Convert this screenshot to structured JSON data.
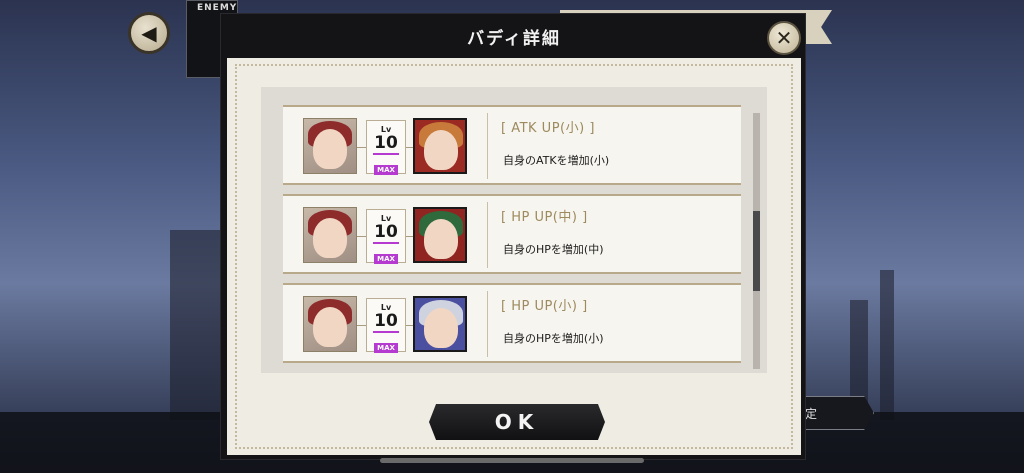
{
  "header": {
    "enemy_label": "ENEMY",
    "back_icon": "chevron-left-icon"
  },
  "background": {
    "right_button_label": "定"
  },
  "modal": {
    "title": "バディ詳細",
    "close_icon": "close-icon",
    "ok_label": "OK",
    "buddies": [
      {
        "level_label": "Lv",
        "level": "10",
        "max_label": "MAX",
        "skill_name": "[ ATK UP(小) ]",
        "skill_desc": "自身のATKを増加(小)",
        "self_hair_color": "#8e2b2b",
        "buddy_bg_color": "#9a2a22",
        "buddy_hair_color": "#c77a3a"
      },
      {
        "level_label": "Lv",
        "level": "10",
        "max_label": "MAX",
        "skill_name": "[ HP UP(中) ]",
        "skill_desc": "自身のHPを増加(中)",
        "self_hair_color": "#8e2b2b",
        "buddy_bg_color": "#8f2420",
        "buddy_hair_color": "#2f6a3c"
      },
      {
        "level_label": "Lv",
        "level": "10",
        "max_label": "MAX",
        "skill_name": "[ HP UP(小) ]",
        "skill_desc": "自身のHPを増加(小)",
        "self_hair_color": "#8e2b2b",
        "buddy_bg_color": "#4b4fa0",
        "buddy_hair_color": "#cfd3e0"
      }
    ]
  },
  "colors": {
    "accent_gold": "#9d8a5e",
    "max_purple": "#b43ad0",
    "panel_dark": "#141416",
    "panel_cream": "#efece4"
  }
}
